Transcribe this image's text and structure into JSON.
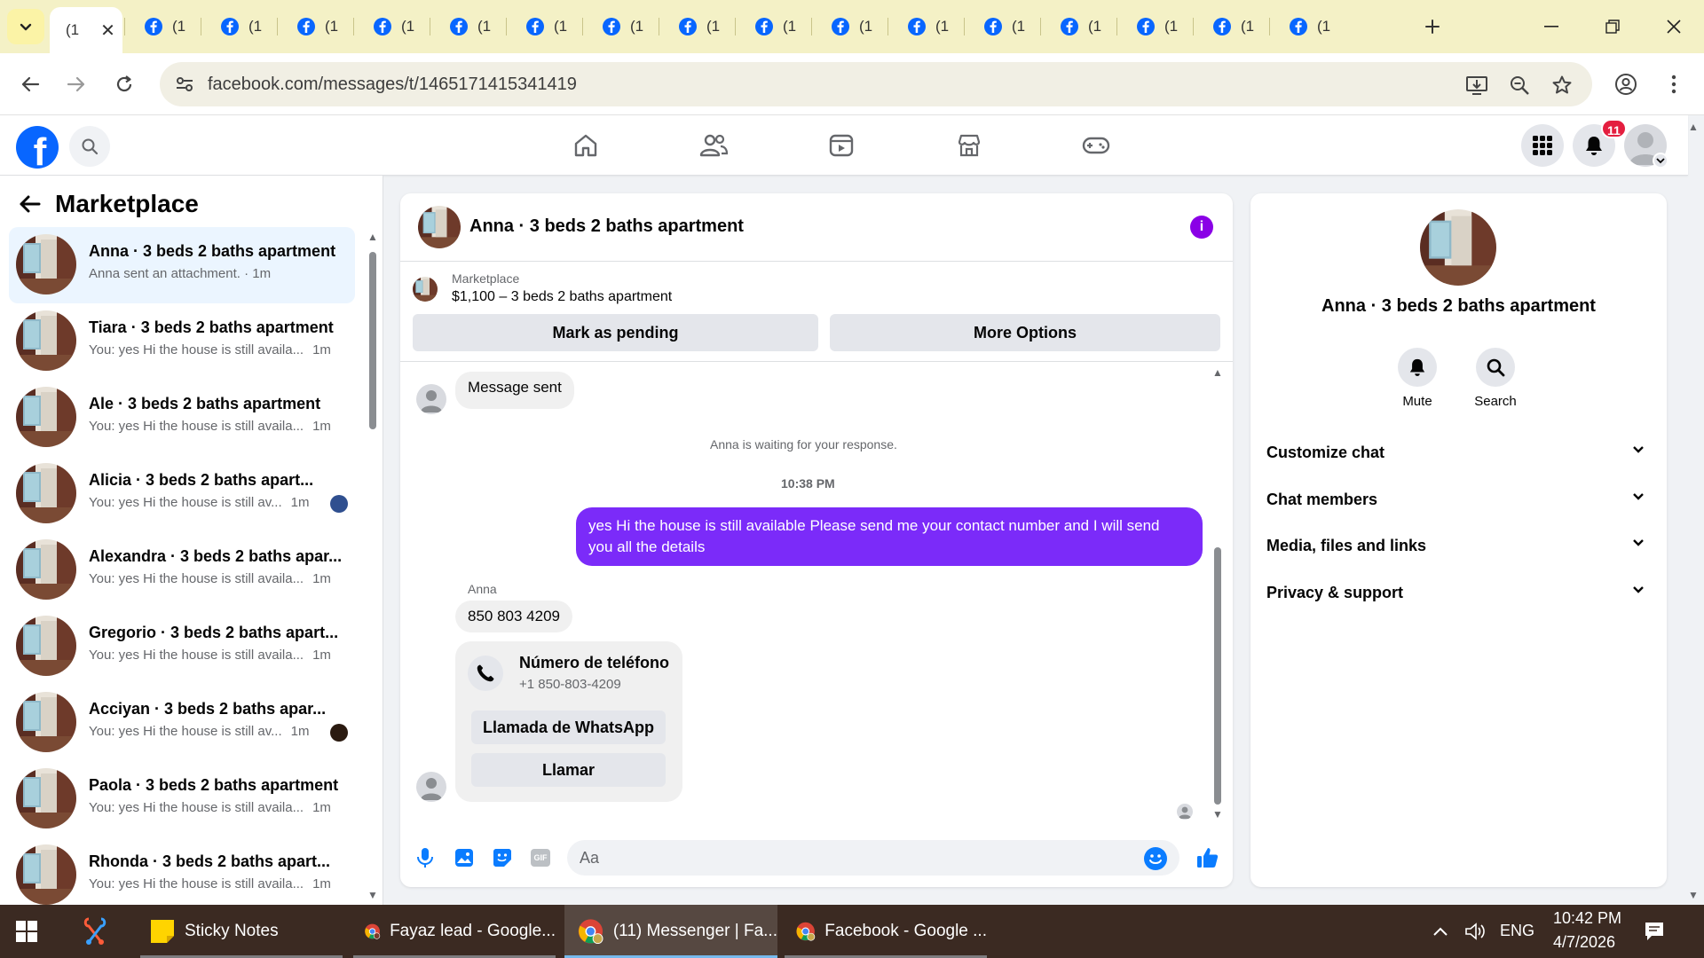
{
  "browser": {
    "active_tab_title": "(1",
    "tab_title": "(1",
    "tab_count": 17,
    "url": "facebook.com/messages/t/1465171415341419"
  },
  "header": {
    "notification_count": "11"
  },
  "sidebar": {
    "title": "Marketplace",
    "chats": [
      {
        "name": "Anna · 3 beds 2 baths apartment",
        "preview": "Anna sent an attachment. · 1m",
        "time": "",
        "selected": true,
        "mini_avatar": ""
      },
      {
        "name": "Tiara · 3 beds 2 baths apartment",
        "preview": "You: yes Hi the house is still availa...",
        "time": "1m",
        "selected": false,
        "mini_avatar": ""
      },
      {
        "name": "Ale · 3 beds 2 baths apartment",
        "preview": "You: yes Hi the house is still availa...",
        "time": "1m",
        "selected": false,
        "mini_avatar": ""
      },
      {
        "name": "Alicia · 3 beds 2 baths apart...",
        "preview": "You: yes Hi the house is still av...",
        "time": "1m",
        "selected": false,
        "mini_avatar": "#2f4f8f"
      },
      {
        "name": "Alexandra · 3 beds 2 baths apar...",
        "preview": "You: yes Hi the house is still availa...",
        "time": "1m",
        "selected": false,
        "mini_avatar": ""
      },
      {
        "name": "Gregorio · 3 beds 2 baths apart...",
        "preview": "You: yes Hi the house is still availa...",
        "time": "1m",
        "selected": false,
        "mini_avatar": ""
      },
      {
        "name": "Acciyan · 3 beds 2 baths apar...",
        "preview": "You: yes Hi the house is still av...",
        "time": "1m",
        "selected": false,
        "mini_avatar": "#2a1a10"
      },
      {
        "name": "Paola · 3 beds 2 baths apartment",
        "preview": "You: yes Hi the house is still availa...",
        "time": "1m",
        "selected": false,
        "mini_avatar": ""
      },
      {
        "name": "Rhonda · 3 beds 2 baths apart...",
        "preview": "You: yes Hi the house is still availa...",
        "time": "1m",
        "selected": false,
        "mini_avatar": ""
      }
    ]
  },
  "conversation": {
    "title": "Anna · 3 beds 2 baths apartment",
    "marketplace_label": "Marketplace",
    "listing": "$1,100 – 3 beds 2 baths apartment",
    "mark_pending_label": "Mark as pending",
    "more_options_label": "More Options",
    "messages": {
      "sent_notice": "Message sent",
      "waiting_notice": "Anna is waiting for your response.",
      "timestamp": "10:38 PM",
      "outgoing_line1": "yes Hi the house is still available Please send me your contact number and I will send",
      "outgoing_line2": "you all the details",
      "sender": "Anna",
      "phone_text": "850 803 4209",
      "card_title": "Número de teléfono",
      "card_number": "+1 850-803-4209",
      "whatsapp_label": "Llamada de WhatsApp",
      "call_label": "Llamar"
    },
    "composer_placeholder": "Aa",
    "gif_label": "GIF"
  },
  "info_panel": {
    "name": "Anna · 3 beds 2 baths apartment",
    "mute_label": "Mute",
    "search_label": "Search",
    "sections": [
      "Customize chat",
      "Chat members",
      "Media, files and links",
      "Privacy & support"
    ]
  },
  "taskbar": {
    "apps": [
      {
        "label": "Sticky Notes"
      },
      {
        "label": "Fayaz lead - Google..."
      },
      {
        "label": "(11) Messenger | Fa..."
      },
      {
        "label": "Facebook - Google ..."
      }
    ],
    "language": "ENG",
    "time": "10:42 PM",
    "date": "4/7/2026"
  },
  "colors": {
    "facebook_blue": "#0866ff",
    "outgoing_bubble": "#7b2bf9",
    "info_purple": "#8a00e6",
    "badge_red": "#e41e3f",
    "tab_strip": "#f4f1c6"
  }
}
